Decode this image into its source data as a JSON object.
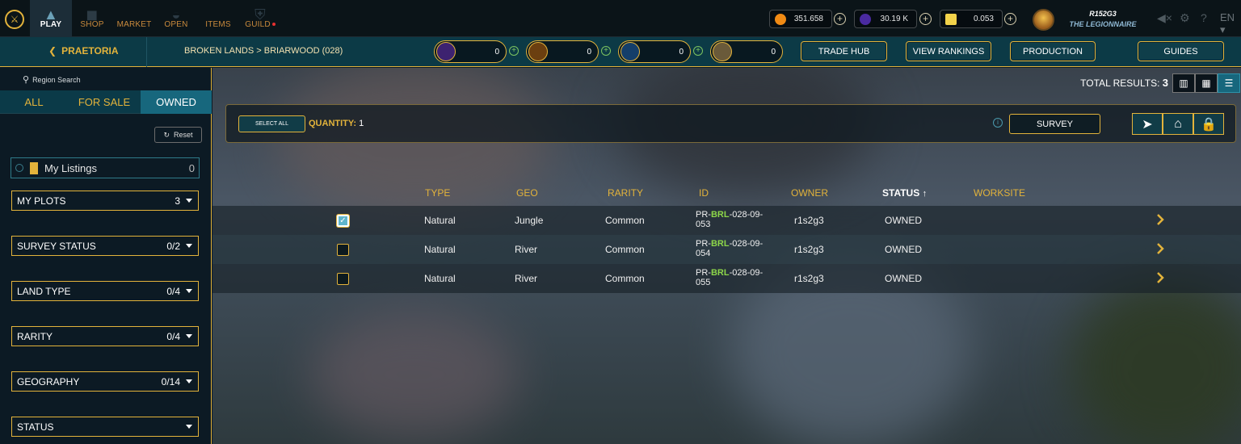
{
  "nav": {
    "items": [
      "PLAY",
      "SHOP",
      "MARKET",
      "OPEN",
      "ITEMS",
      "GUILD"
    ],
    "active": "PLAY"
  },
  "currencies": [
    {
      "name": "coin",
      "value": "351.658",
      "color": "#f08a14"
    },
    {
      "name": "gem",
      "value": "30.19 K",
      "color": "#6b3fd0"
    },
    {
      "name": "ticket",
      "value": "0.053",
      "color": "#f2d24a"
    }
  ],
  "user": {
    "name": "R152G3",
    "title": "THE LEGIONNAIRE"
  },
  "lang": "EN",
  "subbar": {
    "back_label": "PRAETORIA",
    "breadcrumb": "BROKEN LANDS > BRIARWOOD (028)",
    "resources": [
      {
        "name": "essence",
        "value": "0",
        "color": "#8a4fd8"
      },
      {
        "name": "grain",
        "value": "0",
        "color": "#e3a43b"
      },
      {
        "name": "water",
        "value": "0",
        "color": "#3b9ad8"
      },
      {
        "name": "parchment",
        "value": "0",
        "color": "#d8c38a"
      }
    ],
    "buttons": [
      "TRADE HUB",
      "VIEW RANKINGS",
      "PRODUCTION",
      "GUIDES"
    ]
  },
  "sidebar": {
    "search_label": "Region Search",
    "tabs": [
      "ALL",
      "FOR SALE",
      "OWNED"
    ],
    "active_tab": "OWNED",
    "reset_label": "Reset",
    "my_listings": {
      "label": "My Listings",
      "count": "0"
    },
    "filters": [
      {
        "label": "MY PLOTS",
        "count": "3"
      },
      {
        "label": "SURVEY STATUS",
        "count": "0/2"
      },
      {
        "label": "LAND TYPE",
        "count": "0/4"
      },
      {
        "label": "RARITY",
        "count": "0/4"
      },
      {
        "label": "GEOGRAPHY",
        "count": "0/14"
      },
      {
        "label": "STATUS",
        "count": ""
      }
    ]
  },
  "results": {
    "label": "TOTAL RESULTS:",
    "count": "3"
  },
  "toolbar": {
    "select_all": "SELECT ALL",
    "quantity_label": "QUANTITY:",
    "quantity": "1",
    "survey_label": "SURVEY"
  },
  "table": {
    "headers": [
      "TYPE",
      "GEO",
      "RARITY",
      "ID",
      "OWNER",
      "STATUS",
      "WORKSITE"
    ],
    "sort_indicator": "↑",
    "rows": [
      {
        "checked": true,
        "type": "Natural",
        "geo": "Jungle",
        "rarity": "Common",
        "id_prefix": "PR-",
        "id_code": "BRL",
        "id_suffix": "-028-09-",
        "id_num": "053",
        "owner": "r1s2g3",
        "status": "OWNED"
      },
      {
        "checked": false,
        "type": "Natural",
        "geo": "River",
        "rarity": "Common",
        "id_prefix": "PR-",
        "id_code": "BRL",
        "id_suffix": "-028-09-",
        "id_num": "054",
        "owner": "r1s2g3",
        "status": "OWNED"
      },
      {
        "checked": false,
        "type": "Natural",
        "geo": "River",
        "rarity": "Common",
        "id_prefix": "PR-",
        "id_code": "BRL",
        "id_suffix": "-028-09-",
        "id_num": "055",
        "owner": "r1s2g3",
        "status": "OWNED"
      }
    ]
  },
  "colors": {
    "accent": "#e3b33b",
    "teal": "#17677d",
    "highlight_green": "#8dd64a"
  }
}
